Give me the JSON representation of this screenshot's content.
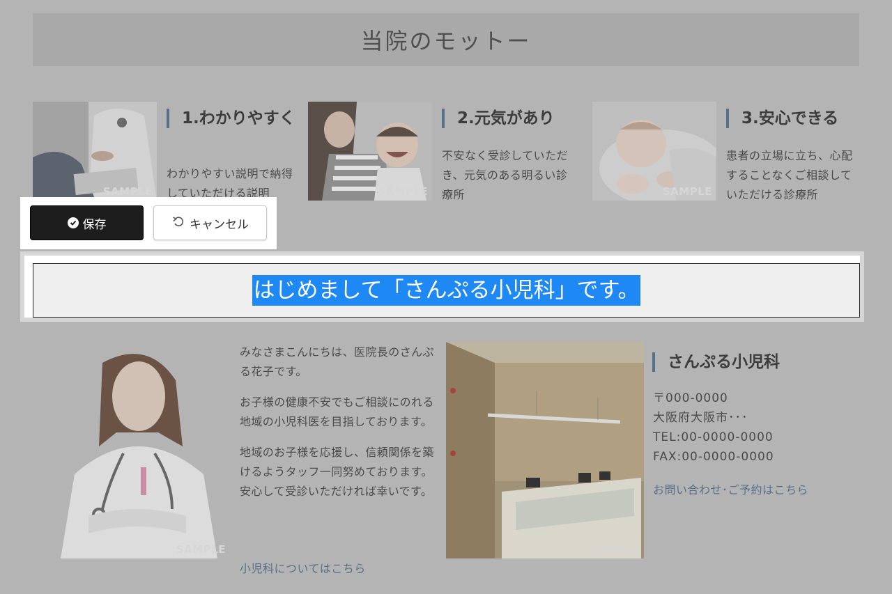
{
  "motto": {
    "heading": "当院のモットー",
    "cards": [
      {
        "title": "1.わかりやすく",
        "text": "わかりやすい説明で納得していただける説明",
        "sample": "SAMPLE"
      },
      {
        "title": "2.元気があり",
        "text": "不安なく受診していただき、元気のある明るい診療所",
        "sample": "SAMPLE"
      },
      {
        "title": "3.安心できる",
        "text": "患者の立場に立ち、心配することなくご相談していただける診療所",
        "sample": "SAMPLE"
      }
    ]
  },
  "toolbar": {
    "save_label": "保存",
    "cancel_label": "キャンセル"
  },
  "editor": {
    "selected_text": "はじめまして「さんぷる小児科」です。"
  },
  "intro": {
    "paragraphs": [
      "みなさまこんにちは、医院長のさんぷる花子です。",
      "お子様の健康不安でもご相談にのれる地域の小児科医を目指しております。",
      "地域のお子様を応援し、信頼関係を築けるようタッフ一同努めております。安心して受診いただければ幸いです。"
    ],
    "link": "小児科についてはこちら",
    "sample": "SAMPLE"
  },
  "clinic": {
    "title": "さんぷる小児科",
    "postal": "〒000-0000",
    "address": "大阪府大阪市･･･",
    "tel": "TEL:00-0000-0000",
    "fax": "FAX:00-0000-0000",
    "link": "お問い合わせ･ご予約はこちら",
    "sample": "SAMPLE"
  },
  "colors": {
    "accent": "#56708a",
    "selection": "#1e88f5",
    "save_button": "#1d1d1d"
  }
}
